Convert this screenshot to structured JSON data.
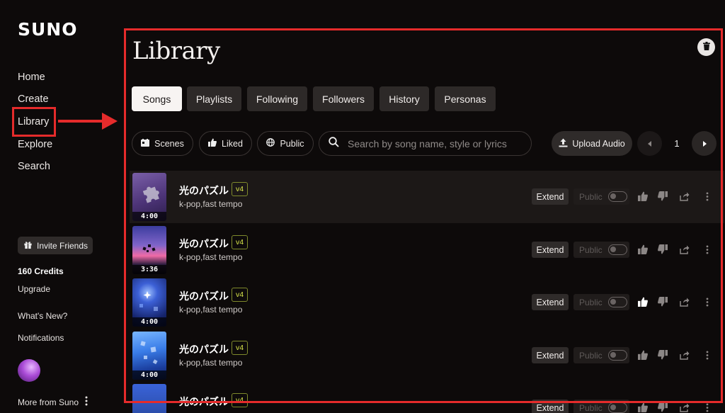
{
  "brand": {
    "logo": "SUNO"
  },
  "sidebar": {
    "nav": [
      "Home",
      "Create",
      "Library",
      "Explore",
      "Search"
    ],
    "invite_label": "Invite Friends",
    "credits": "160 Credits",
    "upgrade": "Upgrade",
    "whats_new": "What's New?",
    "notifications": "Notifications",
    "more_from": "More from Suno"
  },
  "main": {
    "title": "Library",
    "tabs": [
      {
        "label": "Songs",
        "active": true
      },
      {
        "label": "Playlists",
        "active": false
      },
      {
        "label": "Following",
        "active": false
      },
      {
        "label": "Followers",
        "active": false
      },
      {
        "label": "History",
        "active": false
      },
      {
        "label": "Personas",
        "active": false
      }
    ],
    "filters": {
      "scenes": "Scenes",
      "liked": "Liked",
      "public": "Public"
    },
    "search": {
      "placeholder": "Search by song name, style or lyrics",
      "value": ""
    },
    "upload_label": "Upload Audio",
    "page": "1"
  },
  "songs": [
    {
      "title": "光のパズル",
      "version": "v4",
      "tags": "k-pop,fast tempo",
      "duration": "4:00",
      "extend": "Extend",
      "visibility": "Public",
      "liked": false,
      "selected": true
    },
    {
      "title": "光のパズル",
      "version": "v4",
      "tags": "k-pop,fast tempo",
      "duration": "3:36",
      "extend": "Extend",
      "visibility": "Public",
      "liked": false,
      "selected": false
    },
    {
      "title": "光のパズル",
      "version": "v4",
      "tags": "k-pop,fast tempo",
      "duration": "4:00",
      "extend": "Extend",
      "visibility": "Public",
      "liked": true,
      "selected": false
    },
    {
      "title": "光のパズル",
      "version": "v4",
      "tags": "k-pop,fast tempo",
      "duration": "4:00",
      "extend": "Extend",
      "visibility": "Public",
      "liked": false,
      "selected": false
    },
    {
      "title": "光のパズル",
      "version": "v4",
      "tags": "",
      "duration": "",
      "extend": "Extend",
      "visibility": "Public",
      "liked": false,
      "selected": false
    }
  ],
  "colors": {
    "highlight": "#e52b2b",
    "accent_badge": "#d8e54a",
    "background": "#0d0a0a"
  },
  "icons": [
    "gift-icon",
    "kebab-menu-icon",
    "trash-icon",
    "scenes-icon",
    "thumbs-up-icon",
    "globe-icon",
    "search-icon",
    "upload-icon",
    "chevron-left-icon",
    "chevron-right-icon",
    "thumbs-down-icon",
    "share-icon"
  ]
}
